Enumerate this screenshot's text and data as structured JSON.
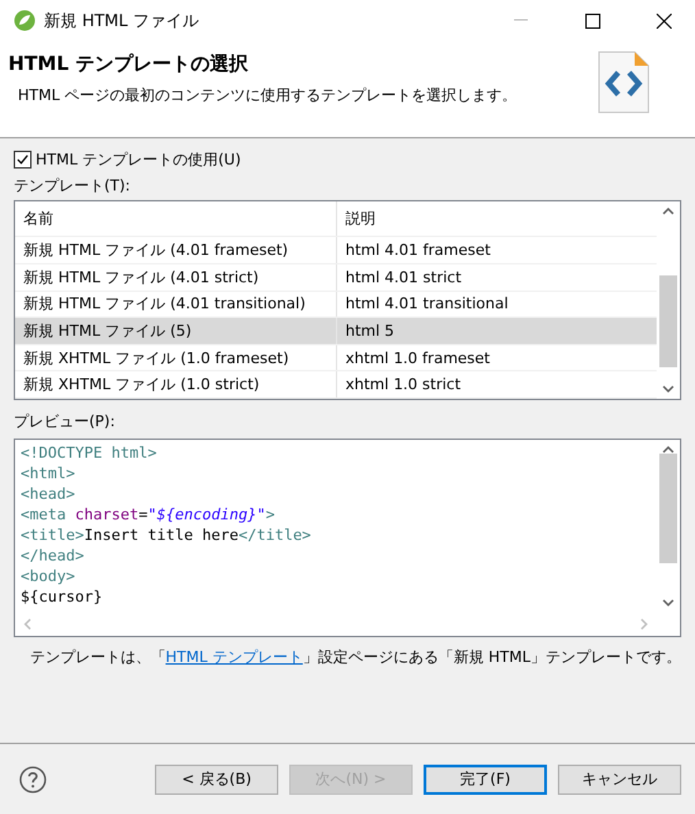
{
  "window": {
    "title": "新規 HTML ファイル"
  },
  "header": {
    "title": "HTML テンプレートの選択",
    "description": "HTML ページの最初のコンテンツに使用するテンプレートを選択します。"
  },
  "use_template": {
    "label": "HTML テンプレートの使用(U)",
    "checked": true
  },
  "templates": {
    "label": "テンプレート(T):",
    "columns": [
      "名前",
      "説明"
    ],
    "rows": [
      {
        "name": "新規 HTML ファイル (4.01 frameset)",
        "description": "html 4.01 frameset",
        "selected": false
      },
      {
        "name": "新規 HTML ファイル (4.01 strict)",
        "description": "html 4.01 strict",
        "selected": false
      },
      {
        "name": "新規 HTML ファイル (4.01 transitional)",
        "description": "html 4.01 transitional",
        "selected": false
      },
      {
        "name": "新規 HTML ファイル (5)",
        "description": "html 5",
        "selected": true
      },
      {
        "name": "新規 XHTML ファイル (1.0 frameset)",
        "description": "xhtml 1.0 frameset",
        "selected": false
      },
      {
        "name": "新規 XHTML ファイル (1.0 strict)",
        "description": "xhtml 1.0 strict",
        "selected": false
      }
    ]
  },
  "preview": {
    "label": "プレビュー(P):",
    "lines": [
      [
        {
          "kind": "tag",
          "text": "<!DOCTYPE html>"
        }
      ],
      [
        {
          "kind": "tag",
          "text": "<html>"
        }
      ],
      [
        {
          "kind": "tag",
          "text": "<head>"
        }
      ],
      [
        {
          "kind": "tag",
          "text": "<meta "
        },
        {
          "kind": "attr",
          "text": "charset"
        },
        {
          "kind": "plain",
          "text": "="
        },
        {
          "kind": "string",
          "text": "\""
        },
        {
          "kind": "variable",
          "text": "${encoding}"
        },
        {
          "kind": "string",
          "text": "\""
        },
        {
          "kind": "tag",
          "text": ">"
        }
      ],
      [
        {
          "kind": "tag",
          "text": "<title>"
        },
        {
          "kind": "plain",
          "text": "Insert title here"
        },
        {
          "kind": "tag",
          "text": "</title>"
        }
      ],
      [
        {
          "kind": "tag",
          "text": "</head>"
        }
      ],
      [
        {
          "kind": "tag",
          "text": "<body>"
        }
      ],
      [
        {
          "kind": "plain",
          "text": "${cursor}"
        }
      ]
    ]
  },
  "note": {
    "before": "テンプレートは、「",
    "link": "HTML テンプレート",
    "after": "」設定ページにある「新規 HTML」テンプレートです。"
  },
  "buttons": [
    {
      "label": "< 戻る(B)",
      "disabled": false,
      "default": false
    },
    {
      "label": "次へ(N) >",
      "disabled": true,
      "default": false
    },
    {
      "label": "完了(F)",
      "disabled": false,
      "default": true
    },
    {
      "label": "キャンセル",
      "disabled": false,
      "default": false
    }
  ]
}
